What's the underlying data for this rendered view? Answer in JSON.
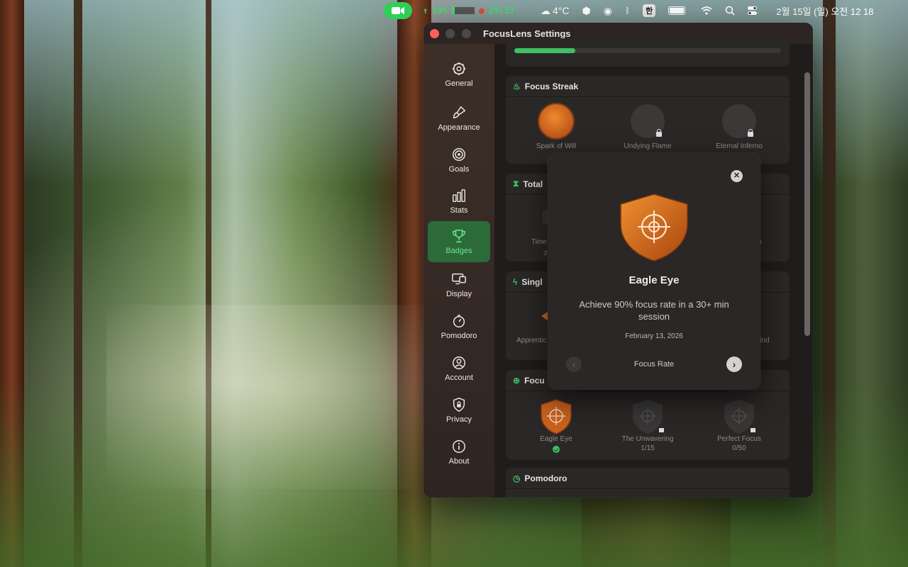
{
  "menubar": {
    "cpu_pct": "10%",
    "timer": "29:33",
    "weather": "4°C",
    "input_lang": "한",
    "datetime": "2월 15일 (일) 오전 12 18"
  },
  "window": {
    "title": "FocusLens Settings"
  },
  "sidebar": {
    "items": [
      {
        "label": "General",
        "icon": "gear-icon"
      },
      {
        "label": "Appearance",
        "icon": "paintbrush-icon"
      },
      {
        "label": "Goals",
        "icon": "target-icon"
      },
      {
        "label": "Stats",
        "icon": "bar-chart-icon"
      },
      {
        "label": "Badges",
        "icon": "trophy-icon"
      },
      {
        "label": "Display",
        "icon": "display-icon"
      },
      {
        "label": "Pomodoro",
        "icon": "timer-icon"
      },
      {
        "label": "Account",
        "icon": "person-icon"
      },
      {
        "label": "Privacy",
        "icon": "lock-icon"
      },
      {
        "label": "About",
        "icon": "info-icon"
      }
    ],
    "active": "Badges"
  },
  "sections": {
    "progress_fraction": 0.23,
    "focus_streak": {
      "title": "Focus Streak",
      "badges": [
        {
          "name": "Spark of Will",
          "unlocked": true
        },
        {
          "name": "Undying Flame",
          "unlocked": false
        },
        {
          "name": "Eternal Inferno",
          "unlocked": false
        }
      ]
    },
    "total": {
      "title": "Total",
      "left_label": "Time",
      "left_count": "3",
      "right_label": "o"
    },
    "single": {
      "title": "Singl",
      "left_label": "Apprentic",
      "right_label": "lind"
    },
    "focus_rate": {
      "title": "Focu",
      "badges": [
        {
          "name": "Eagle Eye",
          "unlocked": true,
          "progress": ""
        },
        {
          "name": "The Unwavering",
          "unlocked": false,
          "progress": "1/15"
        },
        {
          "name": "Perfect Focus",
          "unlocked": false,
          "progress": "0/50"
        }
      ]
    },
    "pomodoro": {
      "title": "Pomodoro"
    }
  },
  "popup": {
    "title": "Eagle Eye",
    "description": "Achieve 90% focus rate in a 30+ min session",
    "date": "February 13, 2026",
    "category": "Focus Rate",
    "colors": {
      "accent": "#e27a26",
      "accent_dark": "#a8460f"
    }
  }
}
